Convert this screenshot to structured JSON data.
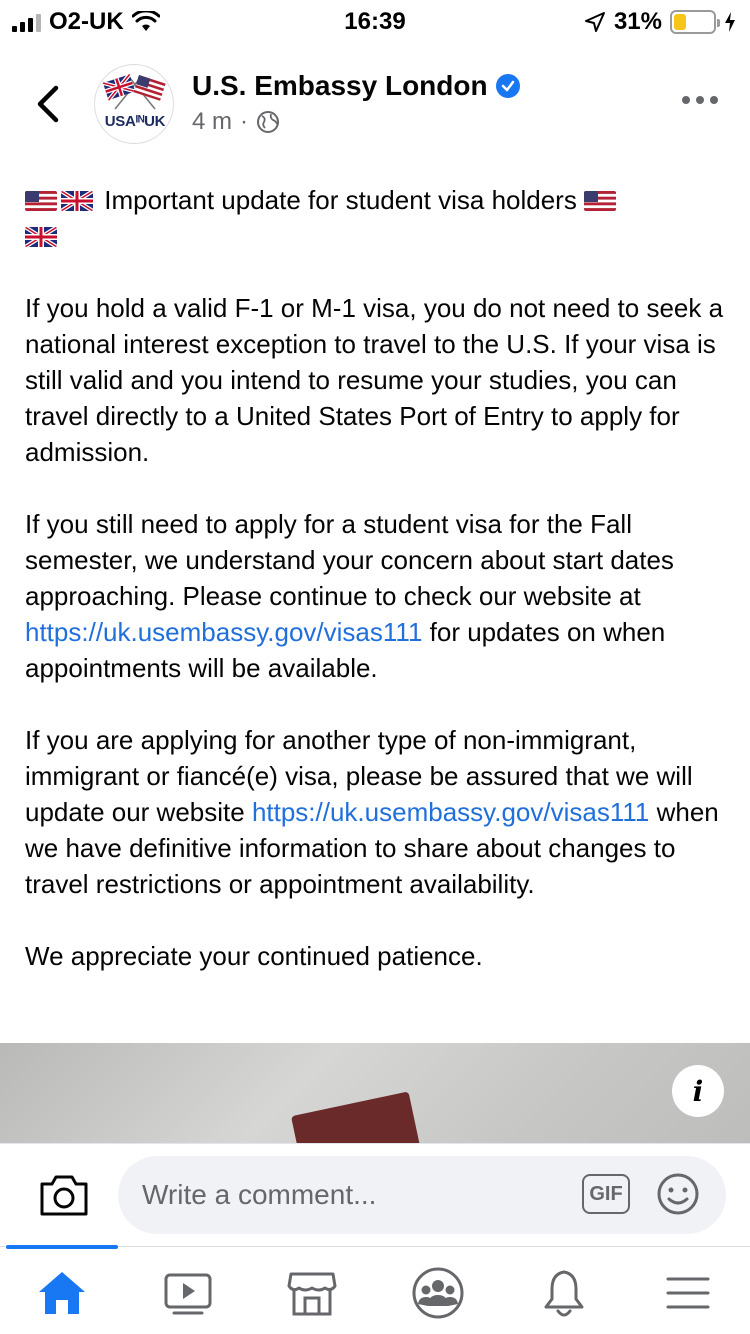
{
  "status_bar": {
    "carrier": "O2-UK",
    "time": "16:39",
    "battery": "31%",
    "battery_level": 0.31
  },
  "header": {
    "page_name": "U.S. Embassy London",
    "avatar_text": "USAᴵᴺUK",
    "time_ago": "4 m",
    "separator": "·",
    "verified": true,
    "audience_icon": "globe-icon"
  },
  "post": {
    "headline": "Important update for student visa holders",
    "paragraphs": [
      {
        "text": "If you hold a valid F-1 or M-1 visa, you do not need to seek a national interest exception to travel to the U.S. If your visa is still valid and you intend to resume your studies, you can travel directly to a United States Port of Entry to apply for admission."
      },
      {
        "before": "If you still need to apply for a student visa for the Fall semester, we understand your concern about start dates approaching. Please continue to check our website at ",
        "link": "https://uk.usembassy.gov/visas111",
        "after": " for updates on when appointments will be available."
      },
      {
        "before": "If you are applying for another type of non-immigrant, immigrant or fiancé(e) visa, please be assured that we will update our website ",
        "link": "https://uk.usembassy.gov/visas111",
        "after": " when we have definitive information to share about changes to travel restrictions or appointment availability."
      },
      {
        "text": "We appreciate your continued patience."
      }
    ]
  },
  "photo": {
    "info_label": "i"
  },
  "comment_bar": {
    "placeholder": "Write a comment...",
    "gif_label": "GIF"
  },
  "tabs": [
    {
      "name": "home",
      "icon": "home-icon",
      "active": true
    },
    {
      "name": "watch",
      "icon": "video-icon",
      "active": false
    },
    {
      "name": "marketplace",
      "icon": "marketplace-icon",
      "active": false
    },
    {
      "name": "groups",
      "icon": "groups-icon",
      "active": false
    },
    {
      "name": "notifications",
      "icon": "bell-icon",
      "active": false
    },
    {
      "name": "menu",
      "icon": "hamburger-icon",
      "active": false
    }
  ],
  "colors": {
    "accent": "#1877f2",
    "link": "#216fdb",
    "secondary_text": "#65676b",
    "battery_fill": "#f5c518"
  }
}
